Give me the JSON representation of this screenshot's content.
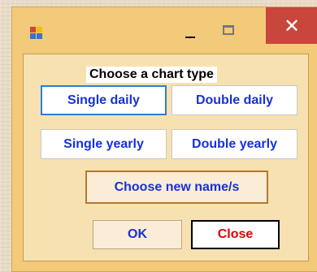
{
  "window": {
    "close_glyph": "✕"
  },
  "main": {
    "heading": "Choose a chart type",
    "buttons": {
      "single_daily": "Single daily",
      "double_daily": "Double daily",
      "single_yearly": "Single yearly",
      "double_yearly": "Double yearly",
      "choose_name": "Choose new name/s",
      "ok": "OK",
      "close": "Close"
    }
  },
  "colors": {
    "window_bg": "#f3c97a",
    "client_bg": "#f8e1b0",
    "button_text_blue": "#1632d6",
    "button_text_red": "#e00000",
    "close_button_bg": "#c8463c"
  },
  "icons": {
    "app": "app-icon",
    "minimize": "minimize-icon",
    "maximize": "maximize-icon",
    "close": "close-icon"
  }
}
